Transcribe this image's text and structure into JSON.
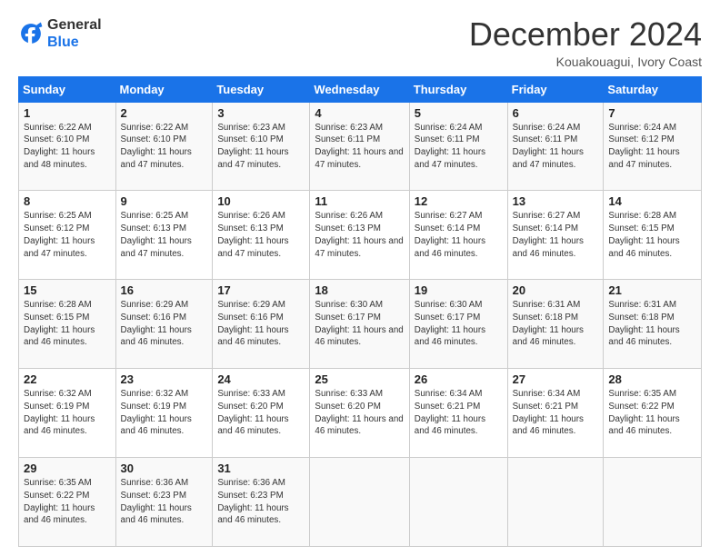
{
  "header": {
    "logo_line1": "General",
    "logo_line2": "Blue",
    "title": "December 2024",
    "location": "Kouakouagui, Ivory Coast"
  },
  "calendar": {
    "days_of_week": [
      "Sunday",
      "Monday",
      "Tuesday",
      "Wednesday",
      "Thursday",
      "Friday",
      "Saturday"
    ],
    "weeks": [
      [
        null,
        {
          "day": "2",
          "sunrise": "6:22 AM",
          "sunset": "6:10 PM",
          "daylight": "11 hours and 47 minutes."
        },
        {
          "day": "3",
          "sunrise": "6:23 AM",
          "sunset": "6:10 PM",
          "daylight": "11 hours and 47 minutes."
        },
        {
          "day": "4",
          "sunrise": "6:23 AM",
          "sunset": "6:11 PM",
          "daylight": "11 hours and 47 minutes."
        },
        {
          "day": "5",
          "sunrise": "6:24 AM",
          "sunset": "6:11 PM",
          "daylight": "11 hours and 47 minutes."
        },
        {
          "day": "6",
          "sunrise": "6:24 AM",
          "sunset": "6:11 PM",
          "daylight": "11 hours and 47 minutes."
        },
        {
          "day": "7",
          "sunrise": "6:24 AM",
          "sunset": "6:12 PM",
          "daylight": "11 hours and 47 minutes."
        }
      ],
      [
        {
          "day": "1",
          "sunrise": "6:22 AM",
          "sunset": "6:10 PM",
          "daylight": "11 hours and 48 minutes."
        },
        {
          "day": "8",
          "sunrise": ""
        },
        null
      ]
    ],
    "rows": [
      [
        {
          "day": "1",
          "sunrise": "6:22 AM",
          "sunset": "6:10 PM",
          "daylight": "11 hours and 48 minutes."
        },
        {
          "day": "2",
          "sunrise": "6:22 AM",
          "sunset": "6:10 PM",
          "daylight": "11 hours and 47 minutes."
        },
        {
          "day": "3",
          "sunrise": "6:23 AM",
          "sunset": "6:10 PM",
          "daylight": "11 hours and 47 minutes."
        },
        {
          "day": "4",
          "sunrise": "6:23 AM",
          "sunset": "6:11 PM",
          "daylight": "11 hours and 47 minutes."
        },
        {
          "day": "5",
          "sunrise": "6:24 AM",
          "sunset": "6:11 PM",
          "daylight": "11 hours and 47 minutes."
        },
        {
          "day": "6",
          "sunrise": "6:24 AM",
          "sunset": "6:11 PM",
          "daylight": "11 hours and 47 minutes."
        },
        {
          "day": "7",
          "sunrise": "6:24 AM",
          "sunset": "6:12 PM",
          "daylight": "11 hours and 47 minutes."
        }
      ],
      [
        {
          "day": "8",
          "sunrise": "6:25 AM",
          "sunset": "6:12 PM",
          "daylight": "11 hours and 47 minutes."
        },
        {
          "day": "9",
          "sunrise": "6:25 AM",
          "sunset": "6:13 PM",
          "daylight": "11 hours and 47 minutes."
        },
        {
          "day": "10",
          "sunrise": "6:26 AM",
          "sunset": "6:13 PM",
          "daylight": "11 hours and 47 minutes."
        },
        {
          "day": "11",
          "sunrise": "6:26 AM",
          "sunset": "6:13 PM",
          "daylight": "11 hours and 47 minutes."
        },
        {
          "day": "12",
          "sunrise": "6:27 AM",
          "sunset": "6:14 PM",
          "daylight": "11 hours and 46 minutes."
        },
        {
          "day": "13",
          "sunrise": "6:27 AM",
          "sunset": "6:14 PM",
          "daylight": "11 hours and 46 minutes."
        },
        {
          "day": "14",
          "sunrise": "6:28 AM",
          "sunset": "6:15 PM",
          "daylight": "11 hours and 46 minutes."
        }
      ],
      [
        {
          "day": "15",
          "sunrise": "6:28 AM",
          "sunset": "6:15 PM",
          "daylight": "11 hours and 46 minutes."
        },
        {
          "day": "16",
          "sunrise": "6:29 AM",
          "sunset": "6:16 PM",
          "daylight": "11 hours and 46 minutes."
        },
        {
          "day": "17",
          "sunrise": "6:29 AM",
          "sunset": "6:16 PM",
          "daylight": "11 hours and 46 minutes."
        },
        {
          "day": "18",
          "sunrise": "6:30 AM",
          "sunset": "6:17 PM",
          "daylight": "11 hours and 46 minutes."
        },
        {
          "day": "19",
          "sunrise": "6:30 AM",
          "sunset": "6:17 PM",
          "daylight": "11 hours and 46 minutes."
        },
        {
          "day": "20",
          "sunrise": "6:31 AM",
          "sunset": "6:18 PM",
          "daylight": "11 hours and 46 minutes."
        },
        {
          "day": "21",
          "sunrise": "6:31 AM",
          "sunset": "6:18 PM",
          "daylight": "11 hours and 46 minutes."
        }
      ],
      [
        {
          "day": "22",
          "sunrise": "6:32 AM",
          "sunset": "6:19 PM",
          "daylight": "11 hours and 46 minutes."
        },
        {
          "day": "23",
          "sunrise": "6:32 AM",
          "sunset": "6:19 PM",
          "daylight": "11 hours and 46 minutes."
        },
        {
          "day": "24",
          "sunrise": "6:33 AM",
          "sunset": "6:20 PM",
          "daylight": "11 hours and 46 minutes."
        },
        {
          "day": "25",
          "sunrise": "6:33 AM",
          "sunset": "6:20 PM",
          "daylight": "11 hours and 46 minutes."
        },
        {
          "day": "26",
          "sunrise": "6:34 AM",
          "sunset": "6:21 PM",
          "daylight": "11 hours and 46 minutes."
        },
        {
          "day": "27",
          "sunrise": "6:34 AM",
          "sunset": "6:21 PM",
          "daylight": "11 hours and 46 minutes."
        },
        {
          "day": "28",
          "sunrise": "6:35 AM",
          "sunset": "6:22 PM",
          "daylight": "11 hours and 46 minutes."
        }
      ],
      [
        {
          "day": "29",
          "sunrise": "6:35 AM",
          "sunset": "6:22 PM",
          "daylight": "11 hours and 46 minutes."
        },
        {
          "day": "30",
          "sunrise": "6:36 AM",
          "sunset": "6:23 PM",
          "daylight": "11 hours and 46 minutes."
        },
        {
          "day": "31",
          "sunrise": "6:36 AM",
          "sunset": "6:23 PM",
          "daylight": "11 hours and 46 minutes."
        },
        null,
        null,
        null,
        null
      ]
    ]
  }
}
